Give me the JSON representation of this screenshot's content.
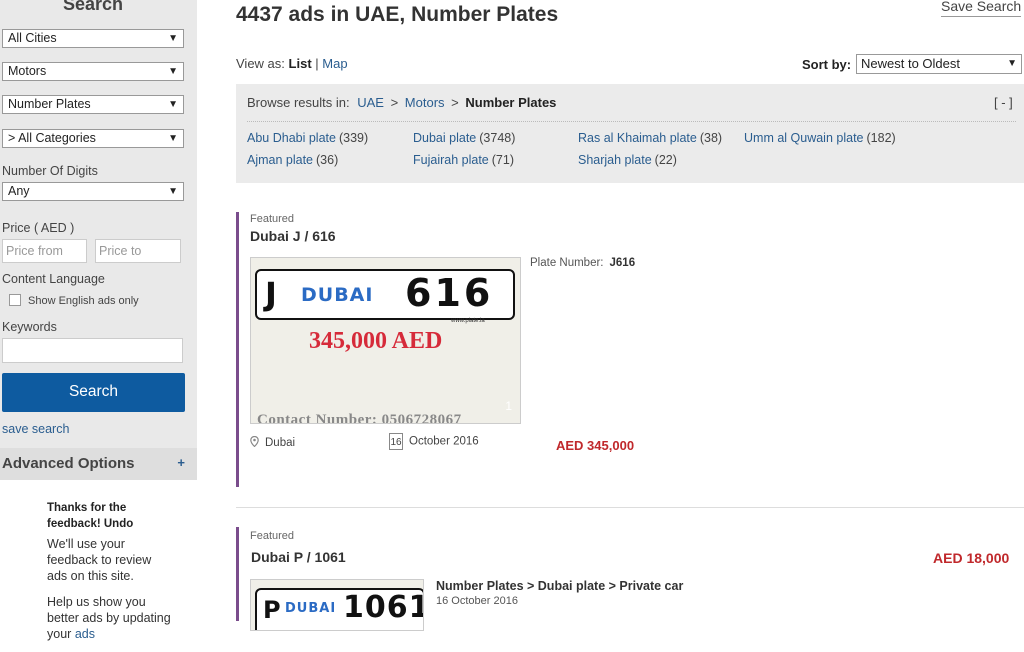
{
  "sidebar": {
    "title": "Search",
    "city_select": "All Cities",
    "section_select": "Motors",
    "subsection_select": "Number Plates",
    "category_select": "> All Categories",
    "digits_label": "Number Of Digits",
    "digits_select": "Any",
    "price_label": "Price ( AED )",
    "price_from_placeholder": "Price from",
    "price_to_placeholder": "Price to",
    "content_language_label": "Content Language",
    "english_only_label": "Show English ads only",
    "keywords_label": "Keywords",
    "search_button": "Search",
    "save_search_link": "save search",
    "advanced_label": "Advanced Options",
    "advanced_icon": "+"
  },
  "feedback": {
    "heading": "Thanks for the feedback! Undo",
    "p1": "We'll use your feedback to review ads on this site.",
    "p2_text": "Help us show you better ads by updating your",
    "p2_link": "ads"
  },
  "header": {
    "title": "4437 ads in UAE, Number Plates",
    "save_search": "Save Search",
    "view_as_label": "View as:",
    "view_list": "List",
    "view_sep": "|",
    "view_map": "Map",
    "sort_label": "Sort by:",
    "sort_value": "Newest to Oldest"
  },
  "browse": {
    "label": "Browse results in:",
    "crumb1": "UAE",
    "crumb2": "Motors",
    "crumb3": "Number Plates",
    "sep": ">",
    "collapse": "[ - ]",
    "categories": [
      {
        "name": "Abu Dhabi plate",
        "count": "(339)"
      },
      {
        "name": "Dubai plate",
        "count": "(3748)"
      },
      {
        "name": "Ras al Khaimah plate",
        "count": "(38)"
      },
      {
        "name": "Umm al Quwain plate",
        "count": "(182)"
      },
      {
        "name": "Ajman plate",
        "count": "(36)"
      },
      {
        "name": "Fujairah plate",
        "count": "(71)"
      },
      {
        "name": "Sharjah plate",
        "count": "(22)"
      }
    ]
  },
  "listings": [
    {
      "featured": "Featured",
      "title": "Dubai J / 616",
      "plate_letter": "J",
      "plate_emirate": "DUBAI",
      "plate_number": "616",
      "plate_site": "www.plate.la",
      "image_price": "345,000 AED",
      "image_footer": "Contact Number: 0506728067",
      "image_count": "1",
      "field_label": "Plate Number:",
      "field_value": "J616",
      "location": "Dubai",
      "day": "16",
      "date": "October 2016",
      "price": "AED 345,000"
    },
    {
      "featured": "Featured",
      "title": "Dubai P / 1061",
      "price": "AED 18,000",
      "plate_letter": "P",
      "plate_emirate": "DUBAI",
      "plate_number": "1061",
      "crumb": "Number Plates > Dubai plate > Private car",
      "date": "16 October 2016"
    }
  ],
  "colors": {
    "accent": "#0e5ba0",
    "price": "#c0282b",
    "featured_bar": "#7a4d8c",
    "link": "#2a5d8f"
  }
}
